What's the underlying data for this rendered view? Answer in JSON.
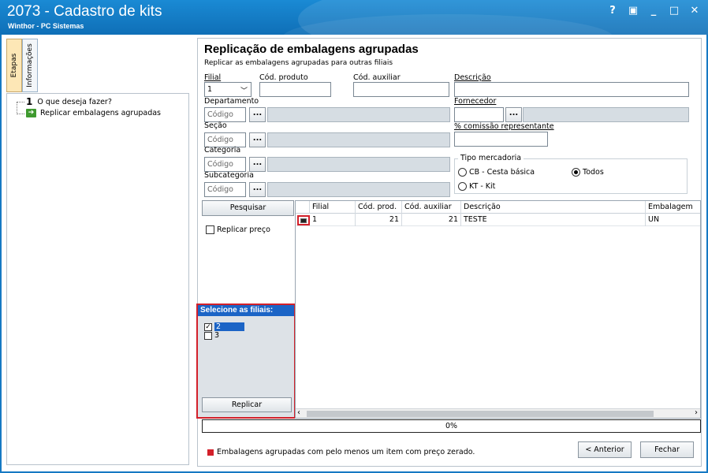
{
  "window": {
    "title": "2073 - Cadastro de kits",
    "subtitle": "Winthor - PC Sistemas",
    "controls": {
      "help": "?",
      "restore": "▣",
      "minimize": "_",
      "maximize": "□",
      "close": "✕"
    }
  },
  "left": {
    "tabs": [
      "Etapas",
      "Informações"
    ],
    "steps": [
      {
        "number": "1",
        "label": "O que deseja fazer?"
      },
      {
        "label": "Replicar embalagens agrupadas"
      }
    ]
  },
  "header": {
    "title": "Replicação de embalagens agrupadas",
    "subtitle": "Replicar as embalagens agrupadas para outras filiais"
  },
  "form": {
    "filial_label": "Filial",
    "filial_value": "1",
    "cod_produto_label": "Cód. produto",
    "cod_auxiliar_label": "Cód. auxiliar",
    "descricao_label": "Descrição",
    "departamento_label": "Departamento",
    "fornecedor_label": "Fornecedor",
    "secao_label": "Seção",
    "comissao_label": "% comissão representante",
    "categoria_label": "Categoria",
    "subcategoria_label": "Subcategoria",
    "codigo_placeholder": "Código",
    "dots": "...",
    "tipo_mercadoria": {
      "label": "Tipo mercadoria",
      "options": [
        "CB - Cesta básica",
        "KT - Kit",
        "Todos"
      ],
      "selected": "Todos"
    }
  },
  "actions": {
    "pesquisar": "Pesquisar",
    "replicar_preco": "Replicar preço",
    "replicar": "Replicar"
  },
  "filiais": {
    "header": "Selecione as filiais:",
    "items": [
      {
        "value": "2",
        "checked": true
      },
      {
        "value": "3",
        "checked": false
      }
    ]
  },
  "grid": {
    "columns": [
      "Filial",
      "Cód. prod.",
      "Cód. auxiliar",
      "Descrição",
      "Embalagem"
    ],
    "rows": [
      {
        "filial": "1",
        "cod_prod": "21",
        "cod_auxiliar": "21",
        "descricao": "TESTE",
        "embalagem": "UN"
      }
    ]
  },
  "progress": {
    "value": 0,
    "text": "0%"
  },
  "footer": {
    "legend": "Embalagens agrupadas com pelo menos um item com preço zerado.",
    "anterior": "< Anterior",
    "fechar": "Fechar"
  },
  "colors": {
    "titlebar": "#1679c3",
    "accent_red": "#d3202a",
    "selection_blue": "#1b64c6"
  }
}
